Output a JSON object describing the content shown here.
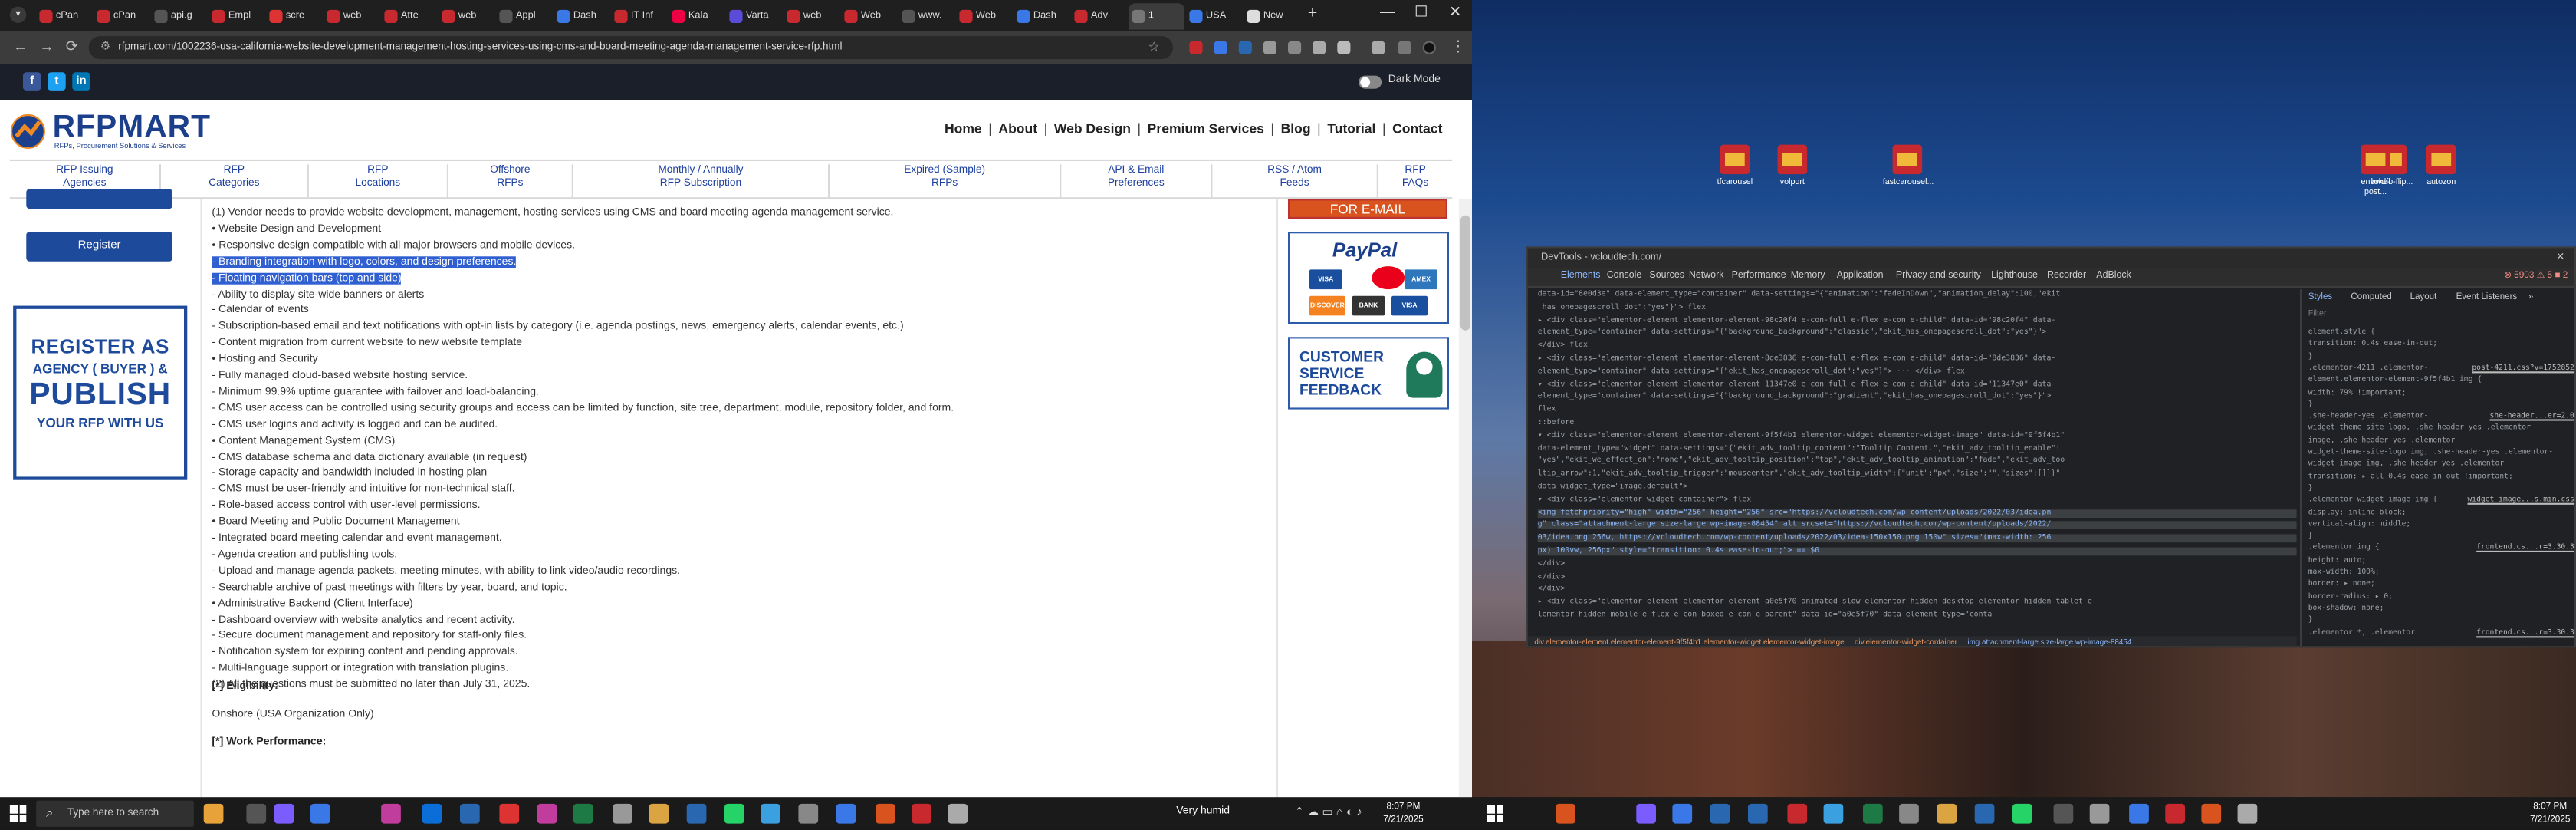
{
  "browser": {
    "tabs": [
      "cPan",
      "cPan",
      "api.g",
      "Empl",
      "scre",
      "web",
      "Atte",
      "web",
      "Appl",
      "Dash",
      "IT Inf",
      "Kala",
      "Varta",
      "web",
      "Web",
      "www.",
      "Web",
      "Dash",
      "Adv",
      "1",
      "USA",
      "New"
    ],
    "new_tab": "+",
    "url": "rfpmart.com/1002236-usa-california-website-development-management-hosting-services-using-cms-and-board-meeting-agenda-management-service-rfp.html",
    "window_controls": {
      "minimize": "—",
      "maximize": "☐",
      "close": "✕"
    },
    "nav": {
      "back": "←",
      "forward": "→",
      "reload": "⟳"
    }
  },
  "site": {
    "topbar": {
      "dark_mode_label": "Dark Mode"
    },
    "logo": {
      "name": "RFPMART",
      "tagline": "RFPs, Procurement Solutions & Services"
    },
    "main_nav": [
      "Home",
      "About",
      "Web Design",
      "Premium Services",
      "Blog",
      "Tutorial",
      "Contact"
    ],
    "category_nav": [
      [
        "RFP Issuing",
        "Agencies"
      ],
      [
        "RFP",
        "Categories"
      ],
      [
        "RFP",
        "Locations"
      ],
      [
        "Offshore",
        "RFPs"
      ],
      [
        "Monthly / Annually",
        "RFP Subscription"
      ],
      [
        "Expired (Sample)",
        "RFPs"
      ],
      [
        "API & Email",
        "Preferences"
      ],
      [
        "RSS / Atom",
        "Feeds"
      ],
      [
        "RFP",
        "FAQs"
      ]
    ],
    "sidebar": {
      "register_button": "Register",
      "promo": {
        "line1": "REGISTER AS",
        "line2": "AGENCY ( BUYER ) &",
        "line3": "PUBLISH",
        "line4": "YOUR RFP WITH US"
      }
    },
    "article": {
      "lines": [
        "(1) Vendor needs to provide website development, management, hosting services using CMS and board meeting agenda management service.",
        "• Website Design and Development",
        "• Responsive design compatible with all major browsers and mobile devices.",
        "- Branding integration with logo, colors, and design preferences.",
        "- Floating navigation bars (top and side)",
        "- Ability to display site-wide banners or alerts",
        "- Calendar of events",
        "- Subscription-based email and text notifications with opt-in lists by category (i.e. agenda postings, news, emergency alerts, calendar events, etc.)",
        "- Content migration from current website to new website template",
        "• Hosting and Security",
        "- Fully managed cloud-based website hosting service.",
        "- Minimum 99.9% uptime guarantee with failover and load-balancing.",
        "- CMS user access can be controlled using security groups and access can be limited by function, site tree, department, module, repository folder, and form.",
        "- CMS user logins and activity is logged and can be audited.",
        "• Content Management System (CMS)",
        "- CMS database schema and data dictionary available (in request)",
        "- Storage capacity and bandwidth included in hosting plan",
        "- CMS must be user-friendly and intuitive for non-technical staff.",
        "- Role-based access control with user-level permissions.",
        "• Board Meeting and Public Document Management",
        "- Integrated board meeting calendar and event management.",
        "- Agenda creation and publishing tools.",
        "- Upload and manage agenda packets, meeting minutes, with ability to link video/audio recordings.",
        "- Searchable archive of past meetings with filters by year, board, and topic.",
        "• Administrative Backend (Client Interface)",
        "- Dashboard overview with website analytics and recent activity.",
        "- Secure document management and repository for staff-only files.",
        "- Notification system for expiring content and pending approvals.",
        "- Multi-language support or integration with translation plugins.",
        "(2) All the questions must be submitted no later than July 31, 2025."
      ],
      "highlighted_lines": [
        3,
        4
      ],
      "eligibility_heading": "[*] Eligibility:",
      "eligibility_text": "Onshore (USA Organization Only)",
      "work_heading": "[*] Work Performance:"
    },
    "right_sidebar": {
      "email_button": "FOR E-MAIL",
      "paypal": "PayPal",
      "cards": [
        "VISA",
        "MC",
        "AMEX",
        "DISCOVER",
        "BANK",
        "VISA"
      ],
      "feedback": [
        "CUSTOMER",
        "SERVICE",
        "FEEDBACK"
      ]
    }
  },
  "desktop": {
    "icons": [
      "tfcarousel",
      "volport",
      "fastcarousel...",
      "bwdfb-flip...",
      "autozon",
      "envoke-post..."
    ],
    "devtools": {
      "title": "DevTools - vcloudtech.com/",
      "close": "✕",
      "tabs": [
        "Elements",
        "Console",
        "Sources",
        "Network",
        "Performance",
        "Memory",
        "Application",
        "Privacy and security",
        "Lighthouse",
        "Recorder",
        "AdBlock"
      ],
      "errors": "⊗ 5903  ⚠ 5  ■ 2",
      "dom_lines": [
        "  data-id=\"8e0d3e\" data-element_type=\"container\" data-settings=\"{\"animation\":\"fadeInDown\",\"animation_delay\":100,\"ekit",
        "  _has_onepagescroll_dot\":\"yes\"}\"> flex",
        "▸ <div class=\"elementor-element elementor-element-98c20f4 e-con-full e-flex e-con e-child\" data-id=\"98c20f4\" data-",
        "  element_type=\"container\" data-settings=\"{\"background_background\":\"classic\",\"ekit_has_onepagescroll_dot\":\"yes\"}\">",
        "  </div> flex",
        "▸ <div class=\"elementor-element elementor-element-8de3836 e-con-full e-flex e-con e-child\" data-id=\"8de3836\" data-",
        "  element_type=\"container\" data-settings=\"{\"ekit_has_onepagescroll_dot\":\"yes\"}\"> ··· </div> flex",
        "▾ <div class=\"elementor-element elementor-element-11347e0 e-con-full e-flex e-con e-child\" data-id=\"11347e0\" data-",
        "  element_type=\"container\" data-settings=\"{\"background_background\":\"gradient\",\"ekit_has_onepagescroll_dot\":\"yes\"}\">",
        "    flex",
        "    ::before",
        "  ▾ <div class=\"elementor-element elementor-element-9f5f4b1 elementor-widget elementor-widget-image\" data-id=\"9f5f4b1\"",
        "    data-element_type=\"widget\" data-settings=\"{\"ekit_adv_tooltip_content\":\"Tooltip Content.\",\"ekit_adv_tooltip_enable\":",
        "    \"yes\",\"ekit_we_effect_on\":\"none\",\"ekit_adv_tooltip_position\":\"top\",\"ekit_adv_tooltip_animation\":\"fade\",\"ekit_adv_too",
        "    ltip_arrow\":1,\"ekit_adv_tooltip_trigger\":\"mouseenter\",\"ekit_adv_tooltip_width\":{\"unit\":\"px\",\"size\":\"\",\"sizes\":[]}}\"",
        "    data-widget_type=\"image.default\">",
        "    ▾ <div class=\"elementor-widget-container\"> flex",
        "        <img fetchpriority=\"high\" width=\"256\" height=\"256\" src=\"https://vcloudtech.com/wp-content/uploads/2022/03/idea.pn",
        "        g\" class=\"attachment-large size-large wp-image-88454\" alt srcset=\"https://vcloudtech.com/wp-content/uploads/2022/",
        "        03/idea.png 256w, https://vcloudtech.com/wp-content/uploads/2022/03/idea-150x150.png 150w\" sizes=\"(max-width: 256",
        "        px) 100vw, 256px\" style=\"transition: 0.4s ease-in-out;\"> == $0",
        "      </div>",
        "    </div>",
        "  </div>",
        "▸ <div class=\"elementor-element elementor-element-a0e5f70 animated-slow elementor-hidden-desktop elementor-hidden-tablet e",
        "  lementor-hidden-mobile e-flex e-con-boxed e-con e-parent\" data-id=\"a0e5f70\" data-element_type=\"conta"
      ],
      "crumbs": [
        "div.elementor-element.elementor-element-9f5f4b1.elementor-widget.elementor-widget-image",
        "div.elementor-widget-container",
        "img.attachment-large.size-large.wp-image-88454"
      ],
      "style_tabs": [
        "Styles",
        "Computed",
        "Layout",
        "Event Listeners",
        "»"
      ],
      "filter_placeholder": "Filter",
      "style_lines": [
        "element.style {",
        "  transition: 0.4s ease-in-out;",
        "}",
        ".elementor-4211 .elementor-",
        "element.elementor-element-9f5f4b1 img {",
        "  width: 79% !important;",
        "}",
        ".she-header-yes .elementor-",
        "widget-theme-site-logo, .she-header-yes .elementor-",
        "image, .she-header-yes .elementor-",
        "widget-theme-site-logo img, .she-header-yes .elementor-",
        "widget-image img, .she-header-yes .elementor-",
        "  transition: ▸ all 0.4s ease-in-out !important;",
        "}",
        ".elementor-widget-image img {",
        "  display: inline-block;",
        "  vertical-align: middle;",
        "}",
        ".elementor img {",
        "  height: auto;",
        "  max-width: 100%;",
        "  border: ▸ none;",
        "  border-radius: ▸ 0;",
        "  box-shadow: none;",
        "}",
        ".elementor *, .elementor"
      ],
      "style_sources": [
        "post-4211.css?v=1752852",
        "she-header...er=2.0",
        "widget-image...s.min.css",
        "frontend.cs...r=3.30.3",
        "frontend.cs...r=3.30.3"
      ]
    }
  },
  "taskbar": {
    "search_placeholder": "Type here to search",
    "weather": "Very humid",
    "clock_left": {
      "time": "8:07 PM",
      "date": "7/21/2025"
    },
    "clock_right": {
      "time": "8:07 PM",
      "date": "7/21/2025"
    }
  },
  "colors": {
    "brand": "#1e4a9c",
    "highlight": "#2f5fd1",
    "email_button": "#d9531e"
  }
}
